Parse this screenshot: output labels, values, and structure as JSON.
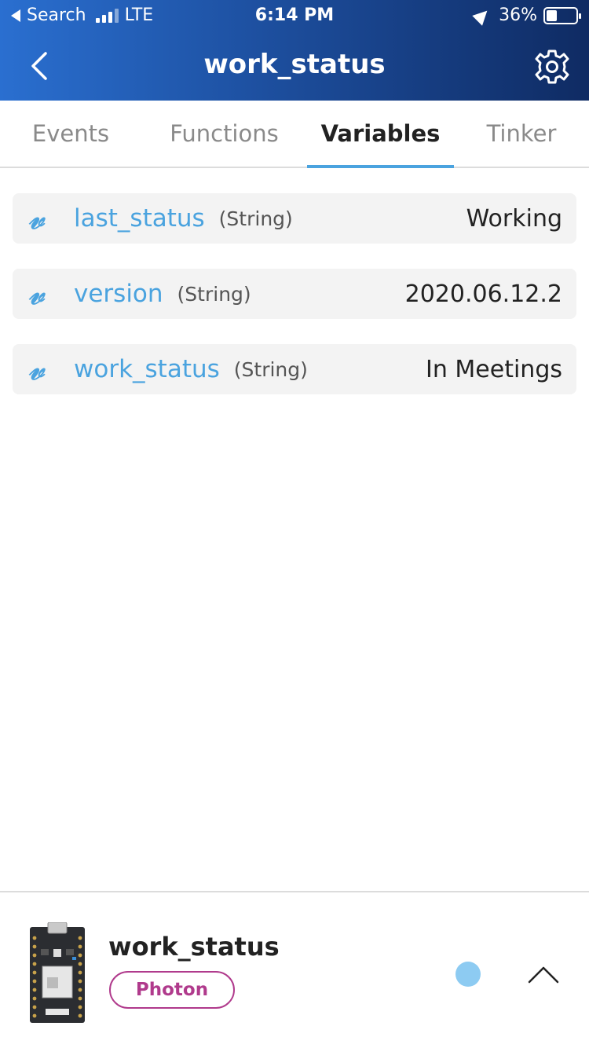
{
  "status_bar": {
    "back_app": "Search",
    "network": "LTE",
    "time": "6:14 PM",
    "battery": "36%",
    "battery_level": 0.36
  },
  "nav": {
    "title": "work_status",
    "back_icon": "chevron-left-icon",
    "settings_icon": "gear-icon"
  },
  "tabs": [
    {
      "label": "Events",
      "active": false
    },
    {
      "label": "Functions",
      "active": false
    },
    {
      "label": "Variables",
      "active": true
    },
    {
      "label": "Tinker",
      "active": false
    }
  ],
  "variables": [
    {
      "icon": "𝓋",
      "name": "last_status",
      "type": "(String)",
      "value": "Working"
    },
    {
      "icon": "𝓋",
      "name": "version",
      "type": "(String)",
      "value": "2020.06.12.2"
    },
    {
      "icon": "𝓋",
      "name": "work_status",
      "type": "(String)",
      "value": "In Meetings"
    }
  ],
  "device": {
    "name": "work_status",
    "type": "Photon",
    "status_color": "#8dcbf2",
    "expand_icon": "chevron-up-icon"
  },
  "colors": {
    "accent": "#4aa3df",
    "header_start": "#2a6fd0",
    "header_end": "#0f2b63",
    "photon_badge": "#b03a8c"
  }
}
